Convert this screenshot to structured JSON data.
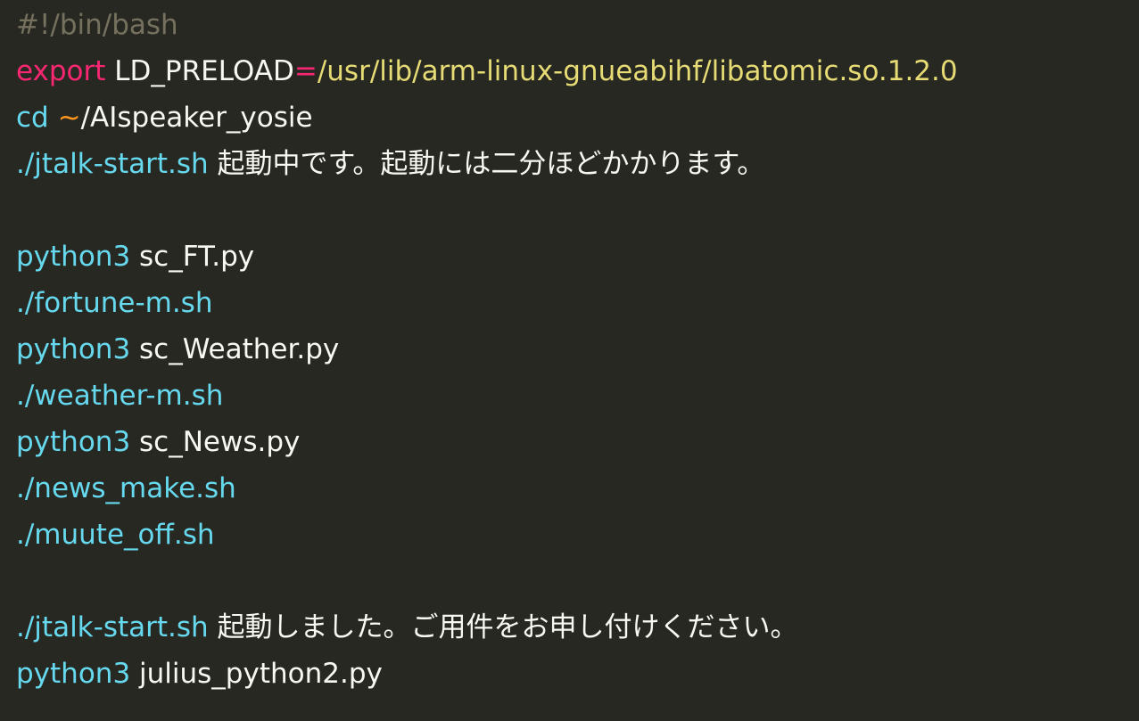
{
  "colors": {
    "background": "#272822",
    "comment": "#75715e",
    "keyword": "#f92672",
    "string": "#e6db74",
    "command": "#66d9ef",
    "tilde": "#fd971f",
    "text": "#f8f8f2"
  },
  "lines": [
    {
      "segments": [
        {
          "text": "#!/bin/bash",
          "kind": "comment"
        }
      ]
    },
    {
      "segments": [
        {
          "text": "export",
          "kind": "keyword"
        },
        {
          "text": " LD_PRELOAD",
          "kind": "plain"
        },
        {
          "text": "=",
          "kind": "keyword"
        },
        {
          "text": "/usr/lib/arm-linux-gnueabihf/libatomic.so.1.2.0",
          "kind": "string"
        }
      ]
    },
    {
      "segments": [
        {
          "text": "cd",
          "kind": "func"
        },
        {
          "text": " ",
          "kind": "plain"
        },
        {
          "text": "~",
          "kind": "op"
        },
        {
          "text": "/AIspeaker_yosie",
          "kind": "plain"
        }
      ]
    },
    {
      "segments": [
        {
          "text": "./jtalk-start.sh",
          "kind": "func"
        },
        {
          "text": " 起動中です。起動には二分ほどかかります。",
          "kind": "plain"
        }
      ]
    },
    {
      "segments": []
    },
    {
      "segments": [
        {
          "text": "python3",
          "kind": "func"
        },
        {
          "text": " sc_FT.py",
          "kind": "plain"
        }
      ]
    },
    {
      "segments": [
        {
          "text": "./fortune-m.sh",
          "kind": "func"
        }
      ]
    },
    {
      "segments": [
        {
          "text": "python3",
          "kind": "func"
        },
        {
          "text": " sc_Weather.py",
          "kind": "plain"
        }
      ]
    },
    {
      "segments": [
        {
          "text": "./weather-m.sh",
          "kind": "func"
        }
      ]
    },
    {
      "segments": [
        {
          "text": "python3",
          "kind": "func"
        },
        {
          "text": " sc_News.py",
          "kind": "plain"
        }
      ]
    },
    {
      "segments": [
        {
          "text": "./news_make.sh",
          "kind": "func"
        }
      ]
    },
    {
      "segments": [
        {
          "text": "./muute_off.sh",
          "kind": "func"
        }
      ]
    },
    {
      "segments": []
    },
    {
      "segments": [
        {
          "text": "./jtalk-start.sh",
          "kind": "func"
        },
        {
          "text": " 起動しました。ご用件をお申し付けください。",
          "kind": "plain"
        }
      ]
    },
    {
      "segments": [
        {
          "text": "python3",
          "kind": "func"
        },
        {
          "text": " julius_python2.py",
          "kind": "plain"
        }
      ]
    }
  ]
}
